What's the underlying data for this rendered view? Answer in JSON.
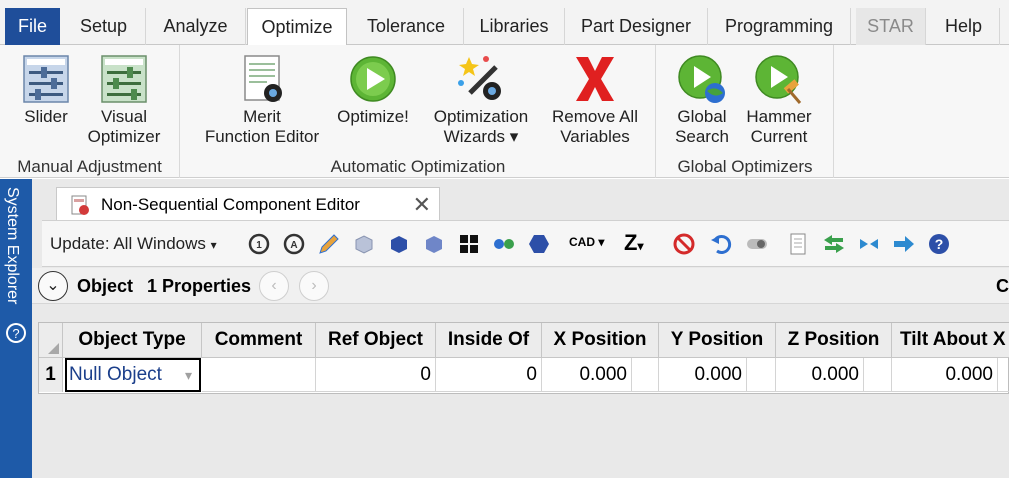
{
  "menu": {
    "tabs": [
      "File",
      "Setup",
      "Analyze",
      "Optimize",
      "Tolerance",
      "Libraries",
      "Part Designer",
      "Programming",
      "STAR",
      "Help"
    ],
    "active": "Optimize",
    "disabled": "STAR"
  },
  "ribbon": {
    "groups": {
      "manual": "Manual Adjustment",
      "automatic": "Automatic Optimization",
      "global": "Global Optimizers"
    },
    "buttons": {
      "slider": "Slider",
      "visual_1": "Visual",
      "visual_2": "Optimizer",
      "merit_1": "Merit",
      "merit_2": "Function Editor",
      "optimize": "Optimize!",
      "wizards_1": "Optimization",
      "wizards_2": "Wizards",
      "wizards_caret": "▾",
      "remove_1": "Remove All",
      "remove_2": "Variables",
      "global_1": "Global",
      "global_2": "Search",
      "hammer_1": "Hammer",
      "hammer_2": "Current"
    }
  },
  "side_panel": {
    "label": "System Explorer",
    "help_glyph": "?"
  },
  "editor": {
    "tab_title": "Non-Sequential Component Editor",
    "close_glyph": "✕",
    "update_label": "Update: All Windows",
    "update_caret": "▾",
    "toolbar_icons": [
      "reload-icon",
      "auto-icon",
      "pencil-icon",
      "cube-icon",
      "solid-icon",
      "block-icon",
      "grid-icon",
      "dots-icon",
      "hexagon-icon",
      "cad-icon",
      "z-icon",
      "no-icon",
      "undo-icon",
      "toggle-icon",
      "doc-icon",
      "arrows-icon",
      "shrink-icon",
      "arrow-right-icon",
      "help-icon"
    ],
    "cad_label": "CAD",
    "z_label": "Z",
    "object_bar": {
      "collapse_glyph": "⌄",
      "object_label": "Object",
      "properties_label": "1 Properties",
      "prev_glyph": "‹",
      "next_glyph": "›",
      "right_clip": "Co"
    },
    "grid": {
      "columns": [
        "Object Type",
        "Comment",
        "Ref Object",
        "Inside Of",
        "X Position",
        "Y Position",
        "Z Position",
        "Tilt About X"
      ],
      "row_number": "1",
      "row": {
        "object_type": "Null Object",
        "dropdown_glyph": "▾",
        "comment": "",
        "ref_object": "0",
        "inside_of": "0",
        "x_position": "0.000",
        "y_position": "0.000",
        "z_position": "0.000",
        "tilt_x": "0.000"
      }
    }
  },
  "colors": {
    "file_tab": "#1f4e9a",
    "side_panel": "#1e5aa8",
    "play_green": "#5db535",
    "remove_red": "#e02020"
  }
}
